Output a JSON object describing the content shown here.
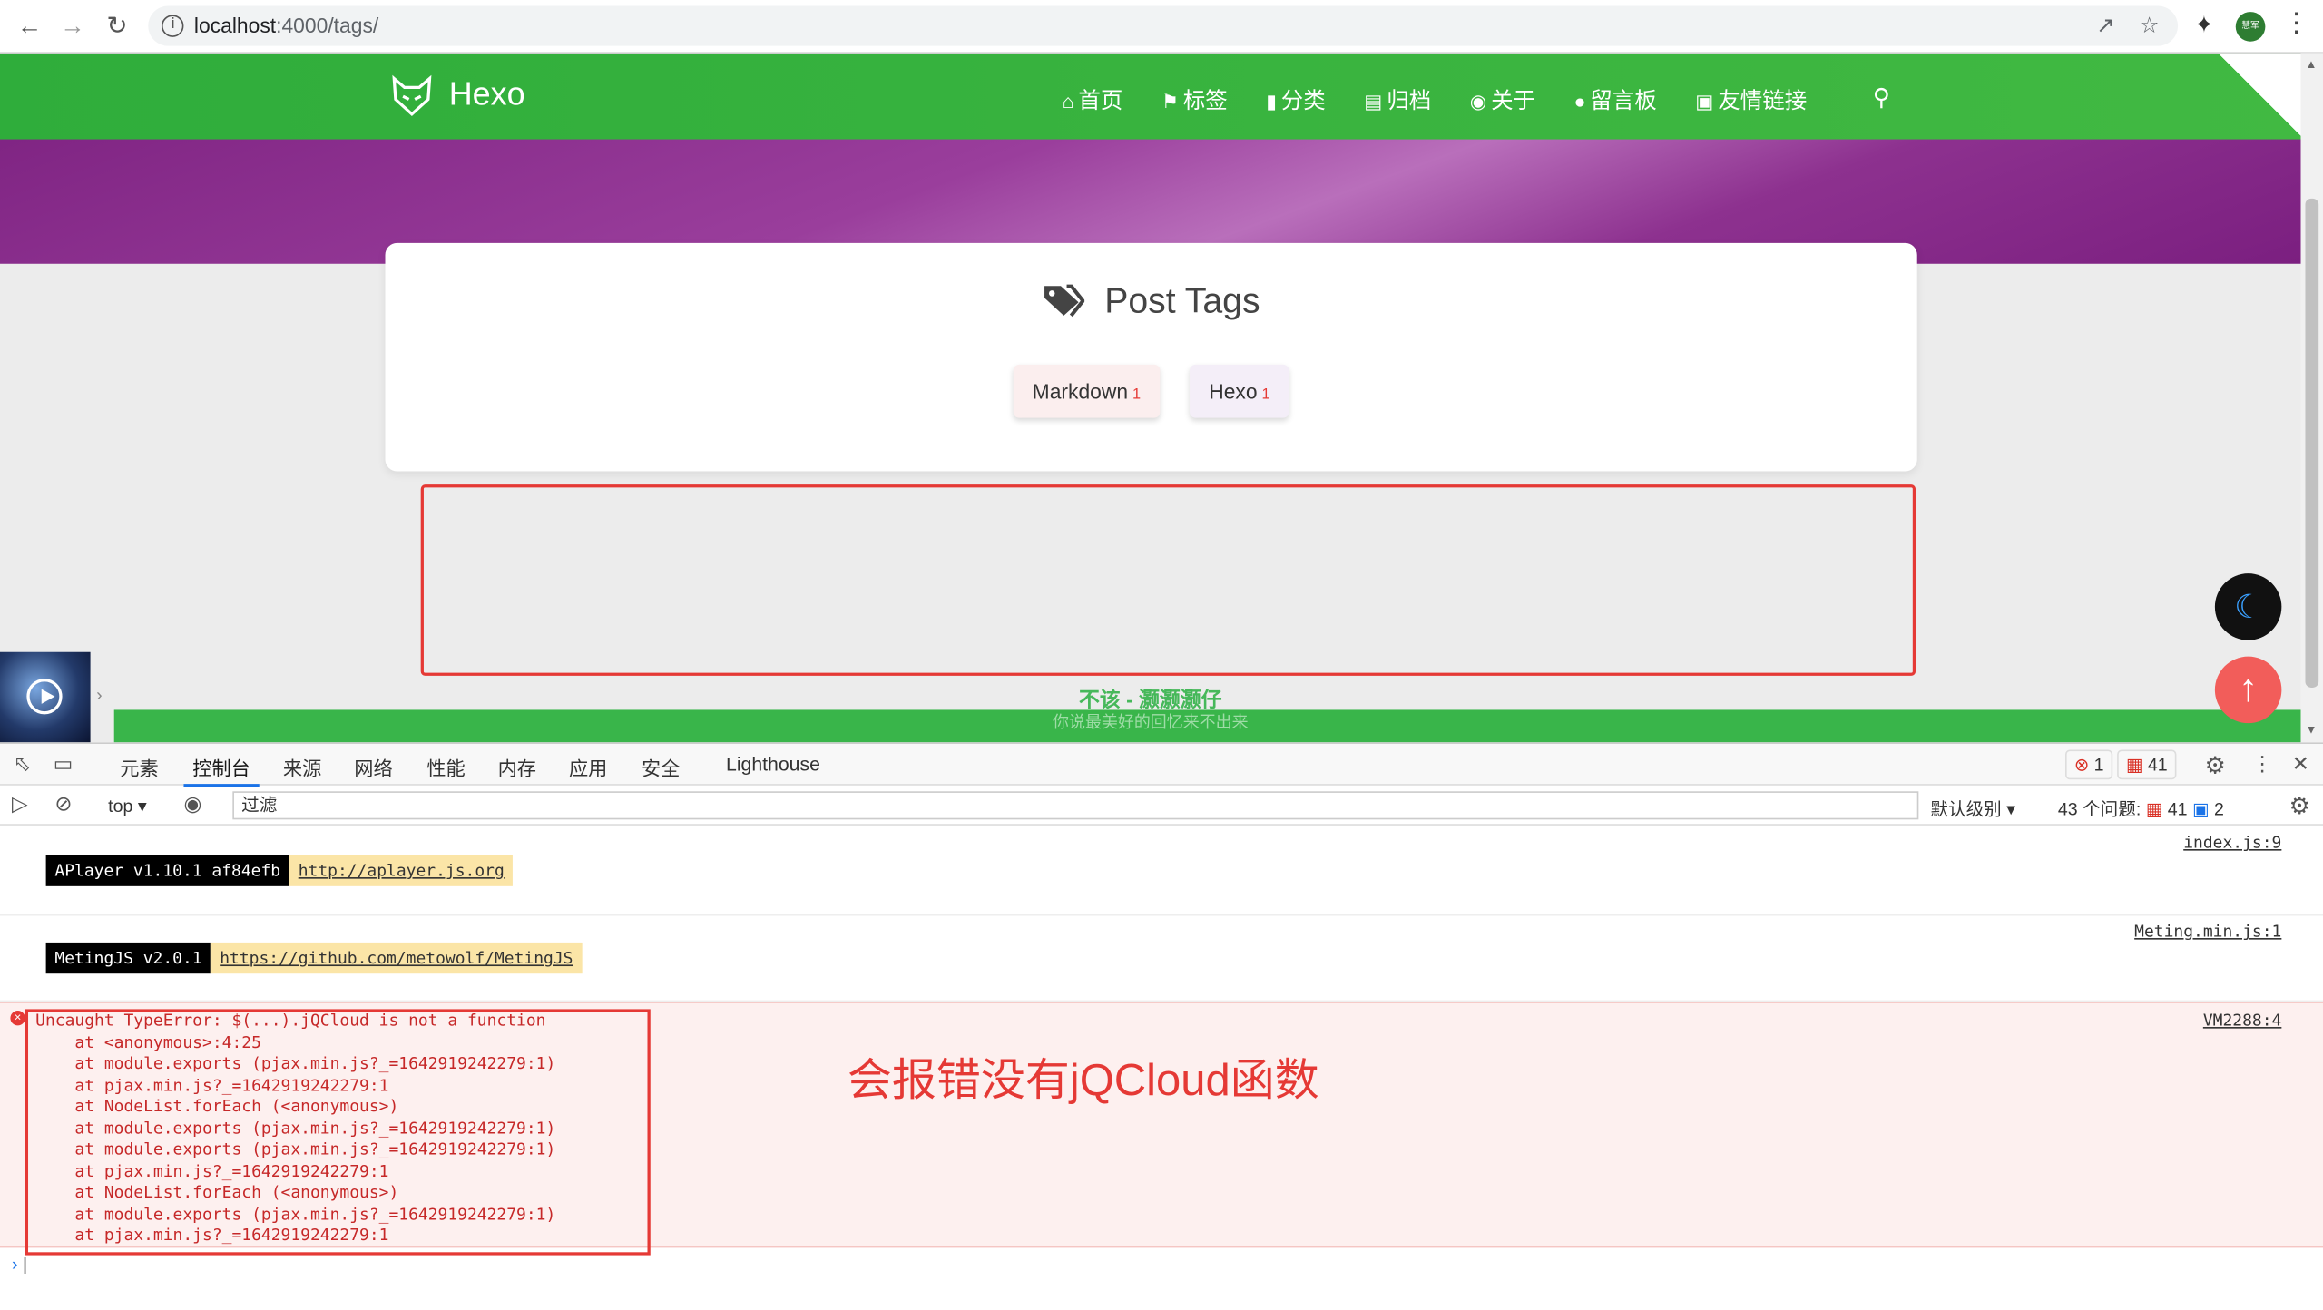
{
  "browser": {
    "url_host": "localhost",
    "url_rest": ":4000/tags/",
    "profile_label": "慧军"
  },
  "site": {
    "brand": "Hexo",
    "menu": [
      {
        "icon": "home-icon",
        "label": "首页"
      },
      {
        "icon": "tags-icon",
        "label": "标签"
      },
      {
        "icon": "bookmark-icon",
        "label": "分类"
      },
      {
        "icon": "archive-icon",
        "label": "归档"
      },
      {
        "icon": "user-circle-icon",
        "label": "关于"
      },
      {
        "icon": "comments-icon",
        "label": "留言板"
      },
      {
        "icon": "address-book-icon",
        "label": "友情链接"
      }
    ],
    "card_title": "Post Tags",
    "tags": [
      {
        "name": "Markdown",
        "count": "1"
      },
      {
        "name": "Hexo",
        "count": "1"
      }
    ],
    "lyric_line": "不该 - 灏灏灏仔",
    "lyric_sub": "你说最美好的回忆来不出来"
  },
  "devtools": {
    "tabs": [
      "元素",
      "控制台",
      "来源",
      "网络",
      "性能",
      "内存",
      "应用",
      "安全",
      "Lighthouse"
    ],
    "active_tab": "控制台",
    "error_badge": "1",
    "warning_badge": "41",
    "context": "top",
    "filter_placeholder": "过滤",
    "levels": "默认级别",
    "issues_label": "43 个问题:",
    "issues_red": "41",
    "issues_blue": "2",
    "logs": [
      {
        "key": "APlayer v1.10.1 af84efb",
        "link": "http://aplayer.js.org",
        "source": "index.js:9"
      },
      {
        "key": "MetingJS v2.0.1",
        "link": "https://github.com/metowolf/MetingJS",
        "source": "Meting.min.js:1"
      }
    ],
    "error": {
      "source": "VM2288:4",
      "lines": [
        "Uncaught TypeError: $(...).jQCloud is not a function",
        "    at <anonymous>:4:25",
        "    at module.exports (pjax.min.js?_=1642919242279:1)",
        "    at pjax.min.js?_=1642919242279:1",
        "    at NodeList.forEach (<anonymous>)",
        "    at module.exports (pjax.min.js?_=1642919242279:1)",
        "    at module.exports (pjax.min.js?_=1642919242279:1)",
        "    at pjax.min.js?_=1642919242279:1",
        "    at NodeList.forEach (<anonymous>)",
        "    at module.exports (pjax.min.js?_=1642919242279:1)",
        "    at pjax.min.js?_=1642919242279:1"
      ]
    },
    "annotation": "会报错没有jQCloud函数"
  },
  "colors": {
    "nav_green": "#2fad3b",
    "banner_purple": "#7a1f7e",
    "error_red": "#e53935"
  }
}
